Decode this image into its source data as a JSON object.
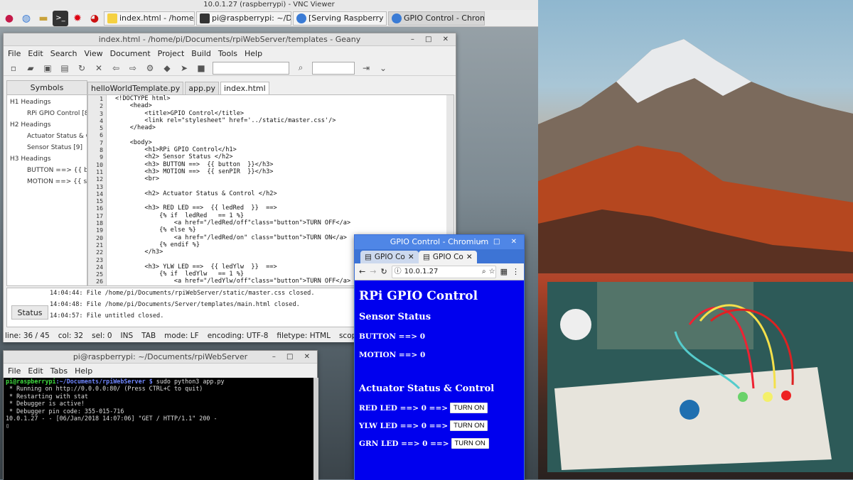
{
  "vnc": {
    "title": "10.0.1.27 (raspberrypi) - VNC Viewer"
  },
  "taskbar": {
    "items": [
      {
        "label": "index.html - /home/pi/..."
      },
      {
        "label": "pi@raspberrypi: ~/Do..."
      },
      {
        "label": "[Serving Raspberry Pi..."
      },
      {
        "label": "GPIO Control - Chrom..."
      }
    ]
  },
  "geany": {
    "title": "index.html - /home/pi/Documents/rpiWebServer/templates - Geany",
    "menu": [
      "File",
      "Edit",
      "Search",
      "View",
      "Document",
      "Project",
      "Build",
      "Tools",
      "Help"
    ],
    "sidebar": {
      "tab": "Symbols",
      "items": [
        "H1 Headings",
        "RPi GPIO Control [8]",
        "H2 Headings",
        "Actuator Status & C",
        "Sensor Status [9]",
        "H3 Headings",
        "BUTTON ==>  {{ bu",
        "MOTION ==>  {{ se"
      ]
    },
    "file_tabs": [
      "helloWorldTemplate.py",
      "app.py",
      "index.html"
    ],
    "line_numbers": [
      "1",
      "2",
      "3",
      "4",
      "5",
      "6",
      "7",
      "8",
      "9",
      "10",
      "11",
      "12",
      "13",
      "14",
      "15",
      "16",
      "17",
      "18",
      "19",
      "20",
      "21",
      "22",
      "23",
      "24",
      "25",
      "26"
    ],
    "code": [
      "<!DOCTYPE html>",
      "    <head>",
      "        <title>GPIO Control</title>",
      "        <link rel=\"stylesheet\" href='../static/master.css'/>",
      "    </head>",
      "",
      "    <body>",
      "        <h1>RPi GPIO Control</h1>",
      "        <h2> Sensor Status </h2>",
      "        <h3> BUTTON ==>  {{ button  }}</h3>",
      "        <h3> MOTION ==>  {{ senPIR  }}</h3>",
      "        <br>",
      "",
      "        <h2> Actuator Status & Control </h2>",
      "",
      "        <h3> RED LED ==>  {{ ledRed  }}  ==>",
      "            {% if  ledRed   == 1 %}",
      "                <a href=\"/ledRed/off\"class=\"button\">TURN OFF</a>",
      "            {% else %}",
      "                <a href=\"/ledRed/on\" class=\"button\">TURN ON</a>",
      "            {% endif %}",
      "        </h3>",
      "",
      "        <h3> YLW LED ==>  {{ ledYlw  }}  ==>",
      "            {% if  ledYlw   == 1 %}",
      "                <a href=\"/ledYlw/off\"class=\"button\">TURN OFF</a>"
    ],
    "status_tab": "Status",
    "messages": [
      "14:04:44: File /home/pi/Documents/rpiWebServer/static/master.css closed.",
      "14:04:48: File /home/pi/Documents/Server/templates/main.html closed.",
      "14:04:57: File untitled closed."
    ],
    "statusbar": [
      "line: 36 / 45",
      "col: 32",
      "sel: 0",
      "INS",
      "TAB",
      "mode: LF",
      "encoding: UTF-8",
      "filetype: HTML",
      "scope:"
    ]
  },
  "terminal": {
    "title": "pi@raspberrypi: ~/Documents/rpiWebServer",
    "menu": [
      "File",
      "Edit",
      "Tabs",
      "Help"
    ],
    "prompt_user": "pi@raspberrypi",
    "prompt_path": ":~/Documents/rpiWebServer $",
    "command": " sudo python3 app.py",
    "lines": [
      " * Running on http://0.0.0.0:80/ (Press CTRL+C to quit)",
      " * Restarting with stat",
      " * Debugger is active!",
      " * Debugger pin code: 355-015-716",
      "10.0.1.27 - - [06/Jan/2018 14:07:06] \"GET / HTTP/1.1\" 200 -"
    ]
  },
  "chromium": {
    "title": "GPIO Control - Chromium",
    "tabs": [
      "GPIO Co",
      "GPIO Co"
    ],
    "url": "10.0.1.27",
    "page": {
      "h1": "RPi GPIO Control",
      "sensor_heading": "Sensor Status",
      "button_line": "BUTTON ==> 0",
      "motion_line": "MOTION ==> 0",
      "actuator_heading": "Actuator Status & Control",
      "leds": [
        {
          "label": "RED LED ==> 0 ==>",
          "button": "TURN ON"
        },
        {
          "label": "YLW LED ==> 0 ==>",
          "button": "TURN ON"
        },
        {
          "label": "GRN LED ==> 0 ==>",
          "button": "TURN ON"
        }
      ]
    }
  }
}
